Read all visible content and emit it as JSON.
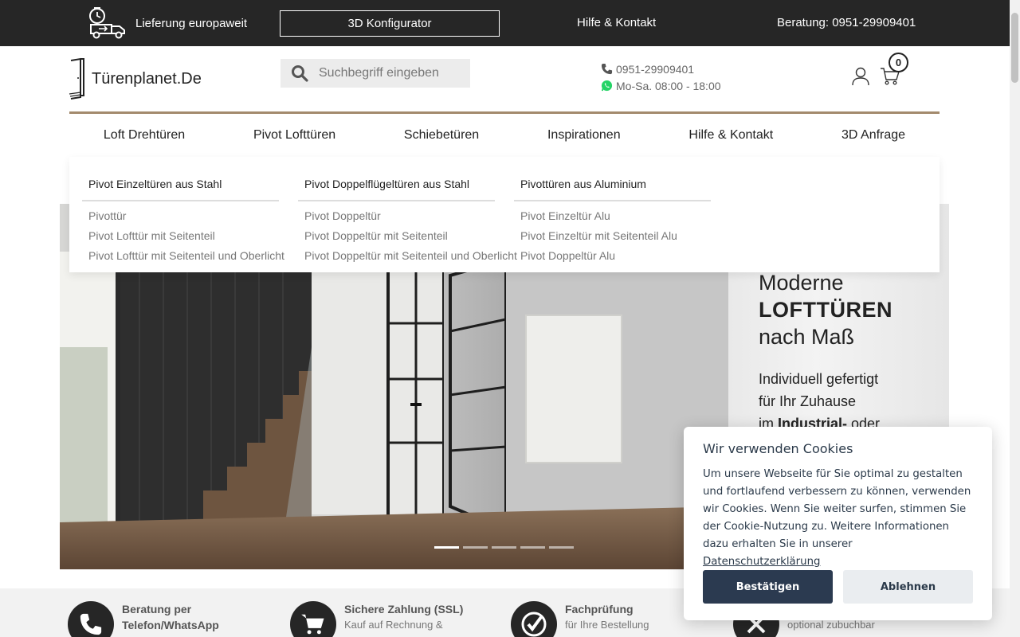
{
  "topbar": {
    "delivery": "Lieferung europaweit",
    "konfigurator": "3D Konfigurator",
    "help": "Hilfe & Kontakt",
    "consult": "Beratung: 0951-29909401"
  },
  "header": {
    "logo": "Türenplanet.De",
    "search_placeholder": "Suchbegriff eingeben",
    "phone": "0951-29909401",
    "hours": "Mo-Sa. 08:00 - 18:00",
    "cart_count": "0"
  },
  "nav": [
    "Loft Drehtüren",
    "Pivot Lofttüren",
    "Schiebetüren",
    "Inspirationen",
    "Hilfe & Kontakt",
    "3D Anfrage"
  ],
  "mega_menu": [
    {
      "heading": "Pivot Einzeltüren aus Stahl",
      "items": [
        "Pivottür",
        "Pivot Lofttür mit Seitenteil",
        "Pivot Lofttür mit Seitenteil und Oberlicht"
      ]
    },
    {
      "heading": "Pivot Doppelflügeltüren aus Stahl",
      "items": [
        "Pivot Doppeltür",
        "Pivot Doppeltür mit Seitenteil",
        "Pivot Doppeltür mit Seitenteil und Oberlicht"
      ]
    },
    {
      "heading": "Pivottüren aus Aluminium",
      "items": [
        "Pivot Einzeltür Alu",
        "Pivot Einzeltür mit Seitenteil Alu",
        "Pivot Doppeltür Alu"
      ]
    }
  ],
  "hero": {
    "line1": "Moderne",
    "line2": "LOFTTÜREN",
    "line3": "nach Maß",
    "sub1": "Individuell gefertigt",
    "sub2": "für Ihr Zuhause",
    "sub3_pre": "im ",
    "sub3_bold": "Industrial-",
    "sub3_post": " oder"
  },
  "features": [
    {
      "title1": "Beratung per",
      "title2": "Telefon/WhatsApp",
      "desc": ""
    },
    {
      "title1": "Sichere Zahlung (SSL)",
      "title2": "",
      "desc": "Kauf auf Rechnung &"
    },
    {
      "title1": "Fachprüfung",
      "title2": "",
      "desc": "für Ihre Bestellung"
    },
    {
      "title1": "",
      "title2": "",
      "desc": "optional zubuchbar"
    }
  ],
  "cookie": {
    "title": "Wir verwenden Cookies",
    "text": "Um unsere Webseite für Sie optimal zu gestalten und fortlaufend verbessern zu können, verwenden wir Cookies. Wenn Sie weiter surfen, stimmen Sie der Cookie-Nutzung zu. Weitere Informationen dazu erhalten Sie in unserer ",
    "link": "Datenschutzerklärung",
    "accept": "Bestätigen",
    "decline": "Ablehnen"
  },
  "colors": {
    "topbar": "#262626",
    "accent_divider": "#a38a6d",
    "cookie_primary": "#2b3a50",
    "whatsapp": "#25d366"
  }
}
